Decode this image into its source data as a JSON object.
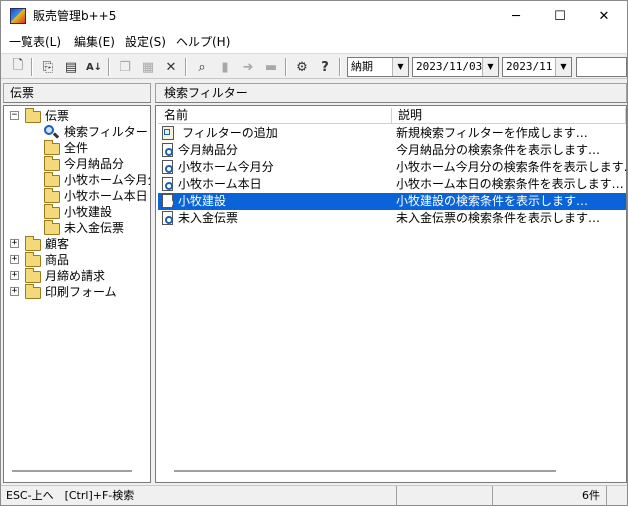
{
  "window": {
    "title": "販売管理b++5",
    "controls": {
      "minimize": "─",
      "maximize": "☐",
      "close": "✕"
    }
  },
  "menu": [
    {
      "label": "一覧表(L)"
    },
    {
      "label": "編集(E)"
    },
    {
      "label": "設定(S)"
    },
    {
      "label": "ヘルプ(H)"
    }
  ],
  "toolbar": {
    "icons": [
      "new-document-icon",
      "folder-up-icon",
      "document-properties-icon",
      "sort-az-icon",
      "copy-icon",
      "paste-icon",
      "delete-icon",
      "find-icon",
      "next-page-icon",
      "arrow-right-icon",
      "move-icon",
      "settings-icon",
      "help-icon"
    ],
    "combo_field": {
      "value": "納期"
    },
    "combo_date": {
      "value": "2023/11/03"
    },
    "combo_month": {
      "value": "2023/11"
    },
    "combo_search": {
      "value": ""
    }
  },
  "left_pane": {
    "header": "伝票",
    "tree": [
      {
        "label": "伝票",
        "expander": "−",
        "icon": "folder"
      },
      {
        "label": "検索フィルター",
        "icon": "search-folder"
      },
      {
        "label": "全件",
        "icon": "folder"
      },
      {
        "label": "今月納品分",
        "icon": "folder"
      },
      {
        "label": "小牧ホーム今月分",
        "icon": "folder"
      },
      {
        "label": "小牧ホーム本日",
        "icon": "folder"
      },
      {
        "label": "小牧建設",
        "icon": "folder"
      },
      {
        "label": "未入金伝票",
        "icon": "folder"
      },
      {
        "label": "顧客",
        "expander": "+",
        "icon": "folder"
      },
      {
        "label": "商品",
        "expander": "+",
        "icon": "folder"
      },
      {
        "label": "月締め請求",
        "expander": "+",
        "icon": "folder"
      },
      {
        "label": "印刷フォーム",
        "expander": "+",
        "icon": "folder"
      }
    ]
  },
  "right_pane": {
    "header": "検索フィルター",
    "columns": {
      "name": "名前",
      "description": "説明"
    },
    "rows": [
      {
        "name": "フィルターの追加",
        "description": "新規検索フィルターを作成します…",
        "icon": "add-filter"
      },
      {
        "name": "今月納品分",
        "description": "今月納品分の検索条件を表示します…",
        "icon": "search-document"
      },
      {
        "name": "小牧ホーム今月分",
        "description": "小牧ホーム今月分の検索条件を表示します…",
        "icon": "search-document"
      },
      {
        "name": "小牧ホーム本日",
        "description": "小牧ホーム本日の検索条件を表示します…",
        "icon": "search-document"
      },
      {
        "name": "小牧建設",
        "description": "小牧建設の検索条件を表示します…",
        "icon": "search-document",
        "selected": true
      },
      {
        "name": "未入金伝票",
        "description": "未入金伝票の検索条件を表示します…",
        "icon": "search-document"
      }
    ]
  },
  "statusbar": {
    "hint": "ESC-上へ　[Ctrl]+F-検索",
    "count": "6件"
  },
  "colors": {
    "selection": "#0a64d8",
    "folder": "#f3d97a"
  }
}
